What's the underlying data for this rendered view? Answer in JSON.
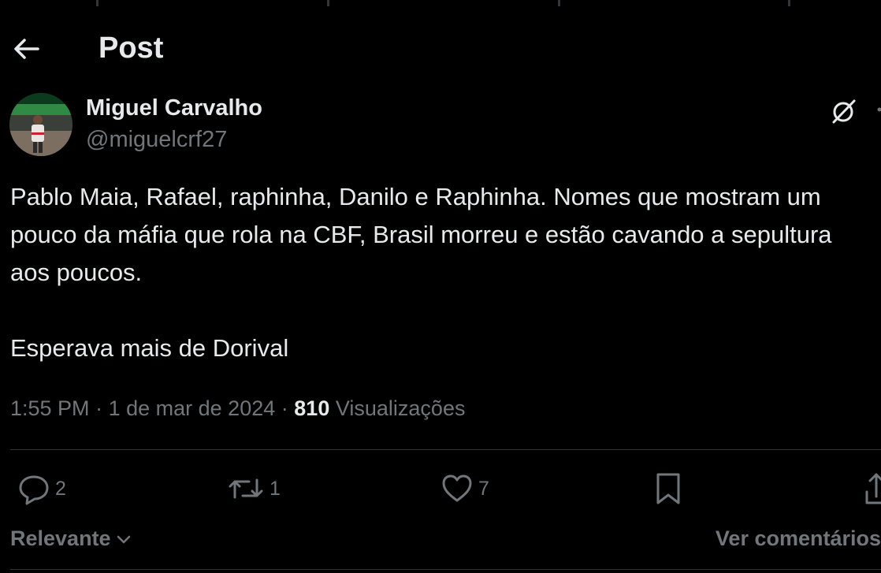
{
  "header": {
    "title": "Post"
  },
  "author": {
    "display_name": "Miguel Carvalho",
    "handle": "@miguelcrf27"
  },
  "tweet": {
    "text": "Pablo Maia, Rafael, raphinha, Danilo e Raphinha. Nomes que mostram um pouco da máfia que rola na CBF, Brasil morreu e estão cavando a sepultura aos poucos.\n\nEsperava mais de Dorival",
    "time": "1:55 PM",
    "separator": "·",
    "date": "1 de mar de 2024",
    "views_count": "810",
    "views_label": "Visualizações"
  },
  "actions": {
    "replies": "2",
    "reposts": "1",
    "likes": "7"
  },
  "replies_section": {
    "sort_label": "Relevante",
    "view_comments": "Ver comentários"
  },
  "icons": [
    "back-arrow-icon",
    "grok-icon",
    "more-icon",
    "reply-icon",
    "repost-icon",
    "like-icon",
    "bookmark-icon",
    "share-icon",
    "chevron-down-icon"
  ],
  "colors": {
    "background": "#000000",
    "text": "#e7e9ea",
    "muted": "#71767b",
    "divider": "#2f3336"
  }
}
